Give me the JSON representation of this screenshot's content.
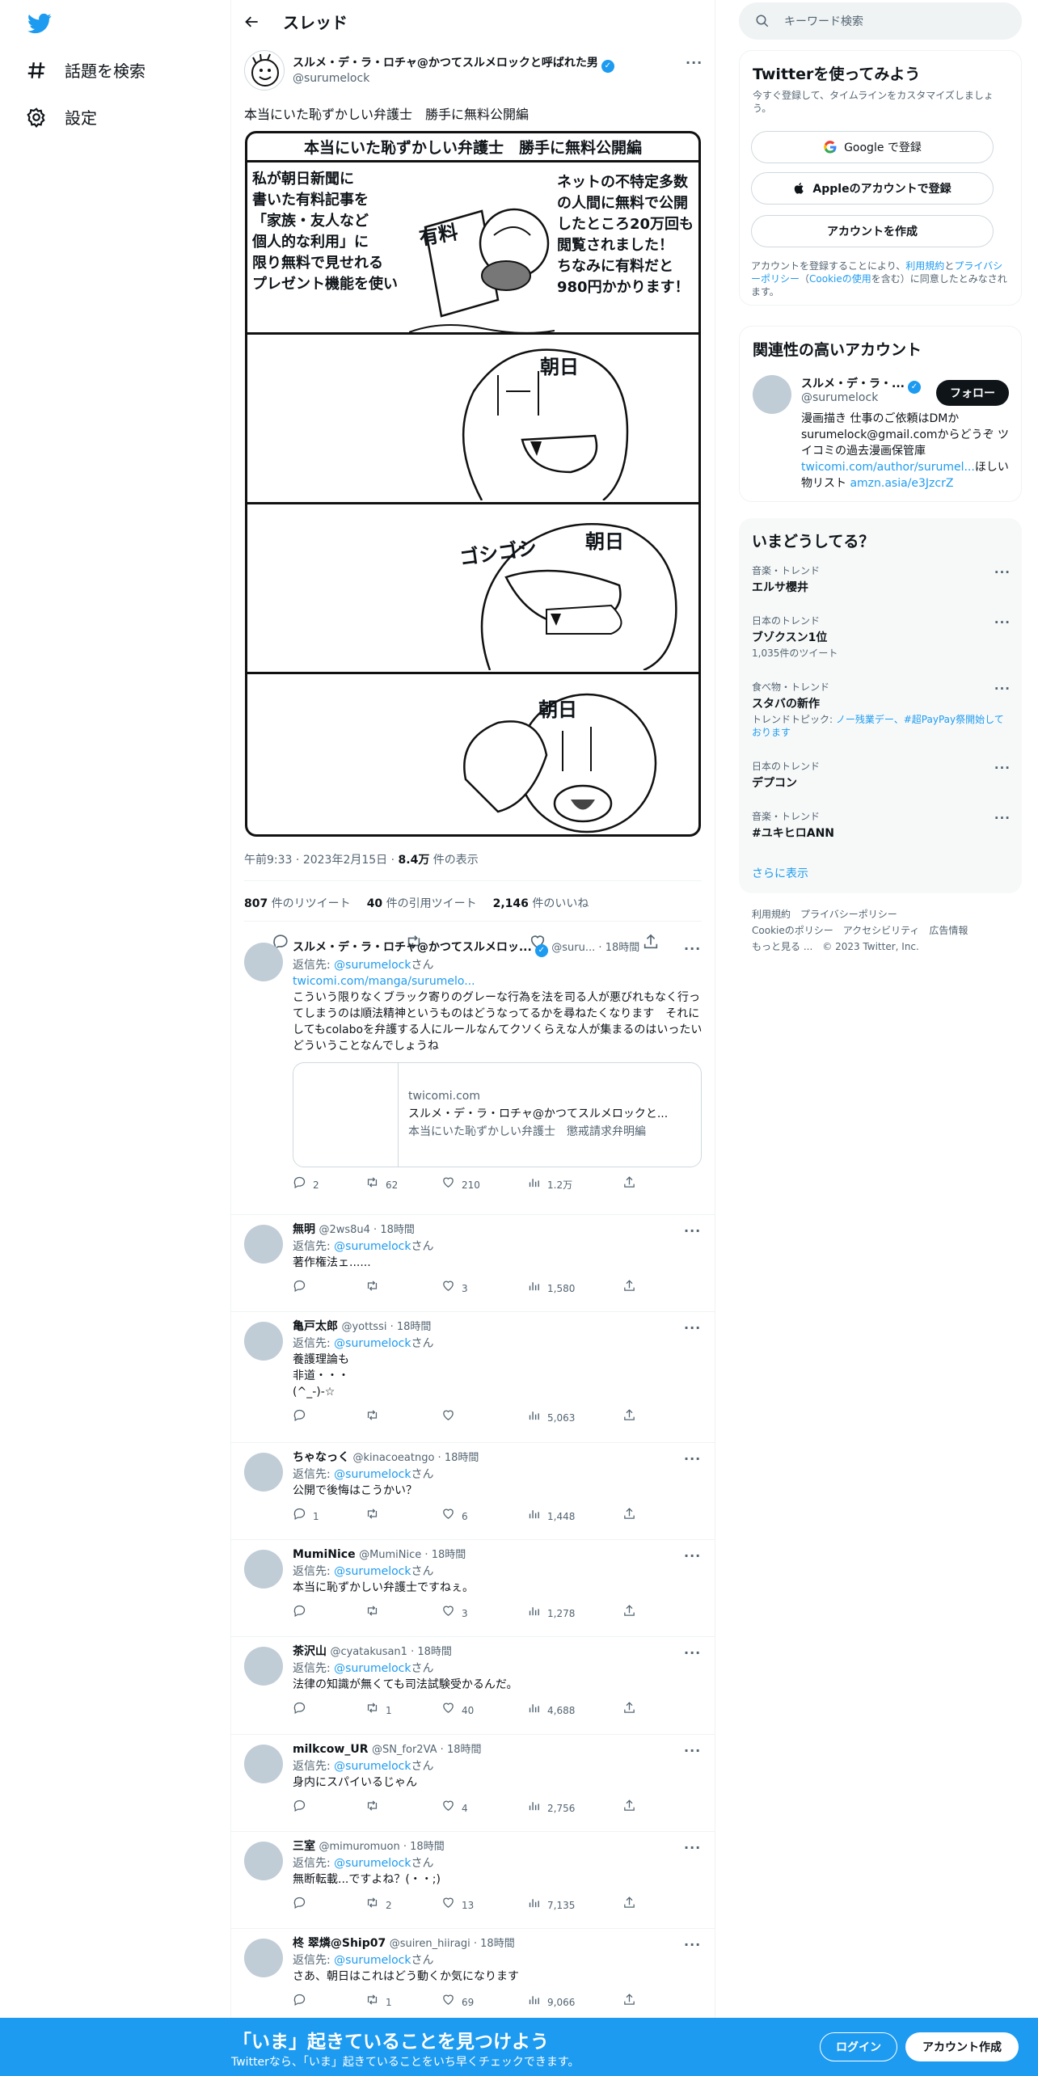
{
  "nav": {
    "explore": "話題を検索",
    "settings": "設定"
  },
  "header": {
    "title": "スレッド"
  },
  "tweet": {
    "author": "スルメ・デ・ラ・ロチャ@かつてスルメロックと呼ばれた男",
    "handle": "@surumelock",
    "text": "本当にいた恥ずかしい弁護士　勝手に無料公開編",
    "manga": {
      "title": "本当にいた恥ずかしい弁護士　勝手に無料公開編",
      "left_text": "私が朝日新聞に\n書いた有料記事を\n「家族・友人など\n個人的な利用」に\n限り無料で見せれる\nプレゼント機能を使い",
      "right_text": "ネットの不特定多数\nの人間に無料で公開\nしたところ20万回も\n閲覧されました！\nちなみに有料だと\n980円かかります！",
      "paid_label": "有料",
      "asahi_label": "朝日",
      "scrub_label": "ゴシゴシ"
    },
    "time": "午前9:33",
    "date": "2023年2月15日",
    "views": "8.4万",
    "views_suffix": "件の表示",
    "retweets": "807",
    "retweets_label": "件のリツイート",
    "quotes": "40",
    "quotes_label": "件の引用ツイート",
    "likes": "2,146",
    "likes_label": "件のいいね"
  },
  "replies": [
    {
      "name": "スルメ・デ・ラ・ロチャ@かつてスルメロッ...",
      "handle": "@suru...",
      "time": "18時間",
      "to_prefix": "返信先: ",
      "to": "@surumelock",
      "to_suffix": "さん",
      "link": "twicomi.com/manga/surumelo...",
      "text": "こういう限りなくブラック寄りのグレーな行為を法を司る人が悪びれもなく行ってしまうのは順法精神というものはどうなってるかを尋ねたくなります　それにしてもcolaboを弁護する人にルールなんてクソくらえな人が集まるのはいったいどういうことなんでしょうね",
      "card": {
        "domain": "twicomi.com",
        "title": "スルメ・デ・ラ・ロチャ@かつてスルメロックと...",
        "desc": "本当にいた恥ずかしい弁護士　懲戒請求弁明編"
      },
      "replies": "2",
      "rts": "62",
      "likes": "210",
      "views": "1.2万"
    },
    {
      "name": "無明",
      "handle": "@2ws8u4",
      "time": "18時間",
      "to_prefix": "返信先: ",
      "to": "@surumelock",
      "to_suffix": "さん",
      "text": "著作権法ェ......",
      "replies": "",
      "rts": "",
      "likes": "3",
      "views": "1,580"
    },
    {
      "name": "亀戸太郎",
      "handle": "@yottssi",
      "time": "18時間",
      "to_prefix": "返信先: ",
      "to": "@surumelock",
      "to_suffix": "さん",
      "text": "養護理論も\n非道・・・\n(^_-)-☆",
      "replies": "",
      "rts": "",
      "likes": "",
      "views": "5,063"
    },
    {
      "name": "ちゃなっく",
      "handle": "@kinacoeatngo",
      "time": "18時間",
      "to_prefix": "返信先: ",
      "to": "@surumelock",
      "to_suffix": "さん",
      "text": "公開で後悔はこうかい？",
      "replies": "1",
      "rts": "",
      "likes": "6",
      "views": "1,448"
    },
    {
      "name": "MumiNice",
      "handle": "@MumiNice",
      "time": "18時間",
      "to_prefix": "返信先: ",
      "to": "@surumelock",
      "to_suffix": "さん",
      "text": "本当に恥ずかしい弁護士ですねぇ。",
      "replies": "",
      "rts": "",
      "likes": "3",
      "views": "1,278"
    },
    {
      "name": "茶沢山",
      "handle": "@cyatakusan1",
      "time": "18時間",
      "to_prefix": "返信先: ",
      "to": "@surumelock",
      "to_suffix": "さん",
      "text": "法律の知識が無くても司法試験受かるんだ。",
      "replies": "",
      "rts": "1",
      "likes": "40",
      "views": "4,688"
    },
    {
      "name": "milkcow_UR",
      "handle": "@SN_for2VA",
      "time": "18時間",
      "to_prefix": "返信先: ",
      "to": "@surumelock",
      "to_suffix": "さん",
      "text": "身内にスパイいるじゃん",
      "replies": "",
      "rts": "",
      "likes": "4",
      "views": "2,756"
    },
    {
      "name": "三室",
      "handle": "@mimuromuon",
      "time": "18時間",
      "to_prefix": "返信先: ",
      "to": "@surumelock",
      "to_suffix": "さん",
      "text": "無断転載...ですよね？(・・;)",
      "replies": "",
      "rts": "2",
      "likes": "13",
      "views": "7,135"
    },
    {
      "name": "柊 翠燐@Ship07",
      "handle": "@suiren_hiiragi",
      "time": "18時間",
      "to_prefix": "返信先: ",
      "to": "@surumelock",
      "to_suffix": "さん",
      "text": "さあ、朝日はこれはどう動くか気になります",
      "replies": "",
      "rts": "1",
      "likes": "69",
      "views": "9,066"
    }
  ],
  "sidebar": {
    "search_placeholder": "キーワード検索",
    "signup": {
      "title": "Twitterを使ってみよう",
      "sub": "今すぐ登録して、タイムラインをカスタマイズしましょう。",
      "google": "Google で登録",
      "apple": "Appleのアカウントで登録",
      "create": "アカウントを作成",
      "terms_a": "アカウントを登録することにより、",
      "terms_link1": "利用規約",
      "terms_b": "と",
      "terms_link2": "プライバシーポリシー",
      "terms_c": "（",
      "terms_link3": "Cookieの使用",
      "terms_d": "を含む）に同意したとみなされます。"
    },
    "related": {
      "title": "関連性の高いアカウント",
      "name": "スルメ・デ・ラ・...",
      "handle": "@surumelock",
      "follow": "フォロー",
      "bio": "漫画描き 仕事のご依頼はDMかsurumelock@gmail.comからどうぞ ツイコミの過去漫画保管庫",
      "bio_link": "twicomi.com/author/surumel...",
      "bio_mid": "ほしい物リスト ",
      "bio_link2": "amzn.asia/e3JzcrZ"
    },
    "trends": {
      "title": "いまどうしてる？",
      "items": [
        {
          "cat": "音楽・トレンド",
          "name": "エルサ櫻井",
          "count": ""
        },
        {
          "cat": "日本のトレンド",
          "name": "ブゾクスン1位",
          "count": "1,035件のツイート"
        },
        {
          "cat": "食べ物・トレンド",
          "name": "スタバの新作",
          "count": "",
          "topics_prefix": "トレンドトピック: ",
          "topics": "ノー残業デー、#超PayPay祭開始しております"
        },
        {
          "cat": "日本のトレンド",
          "name": "デプコン",
          "count": ""
        },
        {
          "cat": "音楽・トレンド",
          "name": "#ユキヒロANN",
          "count": ""
        }
      ],
      "more": "さらに表示"
    },
    "footer": {
      "line1": "利用規約　プライバシーポリシー",
      "line2": "Cookieのポリシー　アクセシビリティ　広告情報",
      "line3": "もっと見る ...　© 2023 Twitter, Inc."
    }
  },
  "bottom": {
    "title": "「いま」起きていることを見つけよう",
    "sub": "Twitterなら、「いま」起きていることをいち早くチェックできます。",
    "login": "ログイン",
    "signup": "アカウント作成"
  },
  "colors": {
    "accent": "#1d9bf0",
    "text": "#0f1419",
    "muted": "#536471"
  }
}
